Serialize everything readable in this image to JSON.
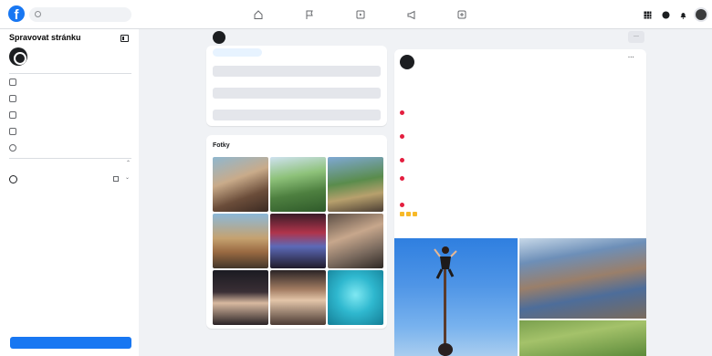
{
  "topbar": {
    "logo_letter": "f",
    "search_placeholder": "",
    "nav": [
      "home-icon",
      "flag-icon",
      "video-icon",
      "megaphone-icon",
      "groups-icon"
    ],
    "right_icons": [
      "apps-grid-icon",
      "messenger-icon",
      "bell-icon"
    ]
  },
  "sidebar": {
    "title": "Spravovat stránku",
    "page_name": "",
    "items": [
      {
        "label": "",
        "icon": "dashboard-icon"
      },
      {
        "label": "",
        "icon": "posts-icon"
      },
      {
        "label": "",
        "icon": "ads-icon"
      },
      {
        "label": "",
        "icon": "campaign-icon"
      },
      {
        "label": "",
        "icon": "settings-icon"
      }
    ],
    "section_title": "",
    "meta_label": "",
    "bottom_button": ""
  },
  "page_header": {
    "name": "",
    "more_label": "···"
  },
  "actions": {
    "pill": "",
    "buttons": [
      "",
      "",
      ""
    ]
  },
  "photos": {
    "title": "Fotky",
    "see_all": ""
  },
  "footer": "",
  "post": {
    "author": "",
    "meta": "",
    "lines": {
      "l1": "",
      "l2": "",
      "l3": "",
      "l4": "",
      "l5": "",
      "t1": "",
      "l6": "",
      "l7": "",
      "t2": "",
      "l8": "",
      "l9": "",
      "t3": "",
      "l10": "",
      "t4": "",
      "l11": "",
      "l12": "",
      "t5": "",
      "more_link": ""
    }
  }
}
